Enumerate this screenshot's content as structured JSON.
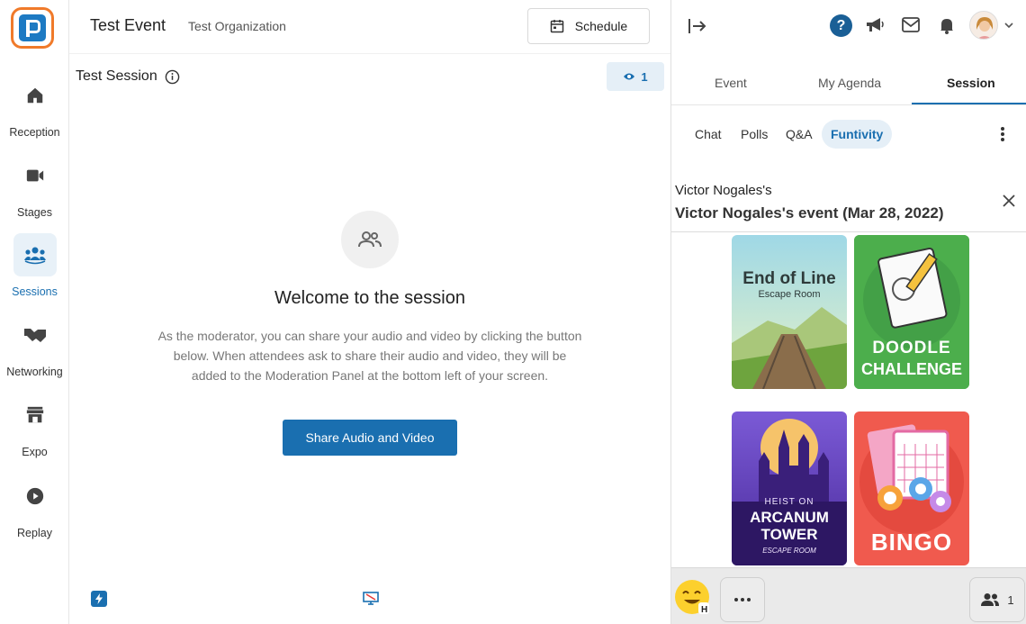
{
  "sidebar": {
    "items": [
      {
        "label": "Reception",
        "icon": "home-icon"
      },
      {
        "label": "Stages",
        "icon": "video-camera-icon"
      },
      {
        "label": "Sessions",
        "icon": "group-icon",
        "active": true
      },
      {
        "label": "Networking",
        "icon": "handshake-icon"
      },
      {
        "label": "Expo",
        "icon": "storefront-icon"
      },
      {
        "label": "Replay",
        "icon": "play-circle-icon"
      }
    ]
  },
  "header": {
    "event_title": "Test Event",
    "organization": "Test Organization",
    "schedule_label": "Schedule"
  },
  "main": {
    "session_title": "Test Session",
    "viewer_count": "1",
    "welcome_title": "Welcome to the session",
    "welcome_description": "As the moderator, you can share your audio and video by clicking the button below. When attendees ask to share their audio and video, they will be added to the Moderation Panel at the bottom left of your screen.",
    "share_button": "Share Audio and Video"
  },
  "panel": {
    "tabs": [
      "Event",
      "My Agenda",
      "Session"
    ],
    "active_tab": "Session",
    "subtabs": [
      "Chat",
      "Polls",
      "Q&A",
      "Funtivity"
    ],
    "active_subtab": "Funtivity",
    "funtivity": {
      "owner": "Victor Nogales's",
      "event_name": "Victor Nogales's event (Mar 28, 2022)"
    },
    "games": [
      {
        "title": "End of Line",
        "subtitle": "Escape Room"
      },
      {
        "title": "DOODLE",
        "subtitle": "CHALLENGE"
      },
      {
        "title": "HEIST ON",
        "subtitle": "ARCANUM TOWER",
        "extra": "ESCAPE ROOM"
      },
      {
        "title": "BINGO"
      }
    ],
    "participant_count": "1"
  },
  "colors": {
    "accent": "#1a6fb0",
    "logo_orange": "#f07a2a",
    "active_bg": "#e5eff7"
  }
}
